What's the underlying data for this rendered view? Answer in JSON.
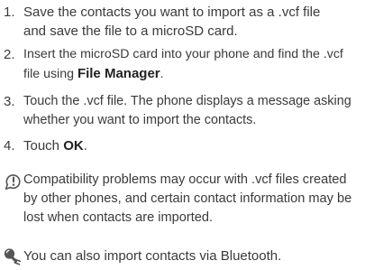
{
  "steps": [
    {
      "number": "1.",
      "line1": "Save the contacts you want to import as a .vcf file",
      "line2": "and save the file to a microSD card."
    },
    {
      "number": "2.",
      "line1": "Insert the microSD card into your phone and find the .vcf",
      "line2_prefix": "file using ",
      "line2_bold": "File Manager",
      "line2_suffix": "."
    },
    {
      "number": "3.",
      "line1": "Touch the .vcf file. The phone displays a message asking",
      "line2": "whether you want to import the contacts."
    },
    {
      "number": "4.",
      "prefix": "Touch ",
      "bold": "OK",
      "suffix": "."
    }
  ],
  "note": {
    "icon": "info-note-icon",
    "line1": "Compatibility problems may occur with .vcf files created",
    "line2": "by other phones, and certain contact information may be",
    "line3": "lost when contacts are imported."
  },
  "tip": {
    "icon": "lightbulb-tip-icon",
    "text": "You can also import contacts via Bluetooth."
  },
  "colors": {
    "text": "#3a3a3a",
    "icon": "#555555"
  }
}
